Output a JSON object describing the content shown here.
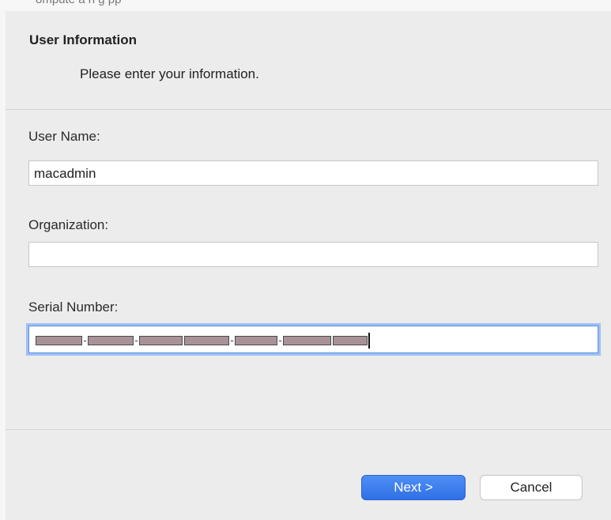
{
  "top_strip": {
    "cut_text": "ompute a  n  g  pp"
  },
  "header": {
    "title": "User Information",
    "subtitle": "Please enter your information."
  },
  "form": {
    "user_name": {
      "label": "User Name:",
      "value": "macadmin"
    },
    "organization": {
      "label": "Organization:",
      "value": ""
    },
    "serial_number": {
      "label": "Serial Number:",
      "value_redacted": true
    }
  },
  "buttons": {
    "next_label": "Next >",
    "cancel_label": "Cancel"
  },
  "colors": {
    "accent": "#3b7ef0",
    "focus_ring": "#9ec0f3",
    "background": "#ececec"
  }
}
